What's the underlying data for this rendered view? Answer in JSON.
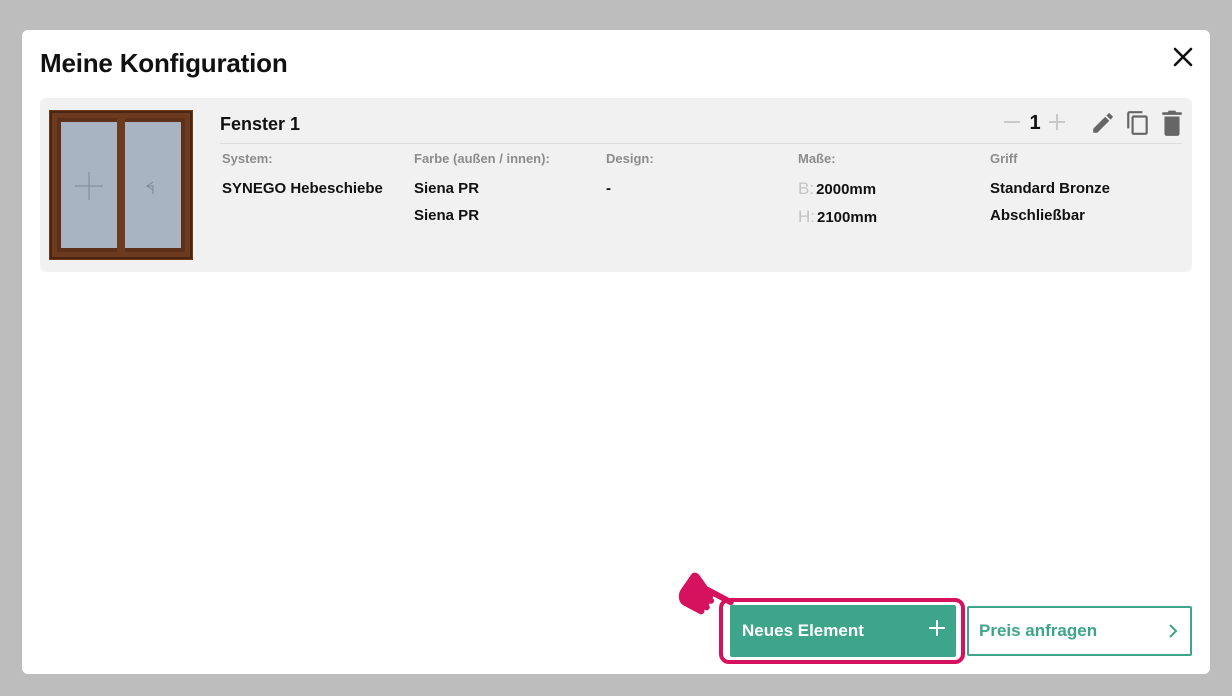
{
  "dialog": {
    "title": "Meine Konfiguration"
  },
  "item": {
    "name": "Fenster 1",
    "quantity": "1",
    "columns": [
      {
        "label": "System:",
        "values": [
          "SYNEGO Hebeschiebe"
        ]
      },
      {
        "label": "Farbe (außen / innen):",
        "values": [
          "Siena PR",
          "Siena PR"
        ]
      },
      {
        "label": "Design:",
        "values": [
          "-"
        ]
      },
      {
        "label": "Maße:",
        "width_prefix": "B:",
        "width": "2000mm",
        "height_prefix": "H:",
        "height": "2100mm"
      },
      {
        "label": "Griff",
        "values": [
          "Standard Bronze",
          "Abschließbar"
        ]
      }
    ]
  },
  "actions": {
    "new_element": "Neues Element",
    "request_price": "Preis anfragen"
  },
  "colors": {
    "accent": "#3da58a",
    "highlight": "#d6125e",
    "frame": "#6b3a1f",
    "glass": "#a9b4c2"
  },
  "icons": [
    "close-icon",
    "minus-icon",
    "plus-icon",
    "pencil-icon",
    "copy-icon",
    "trash-icon",
    "chevron-right-icon",
    "hand-pointer-icon"
  ]
}
